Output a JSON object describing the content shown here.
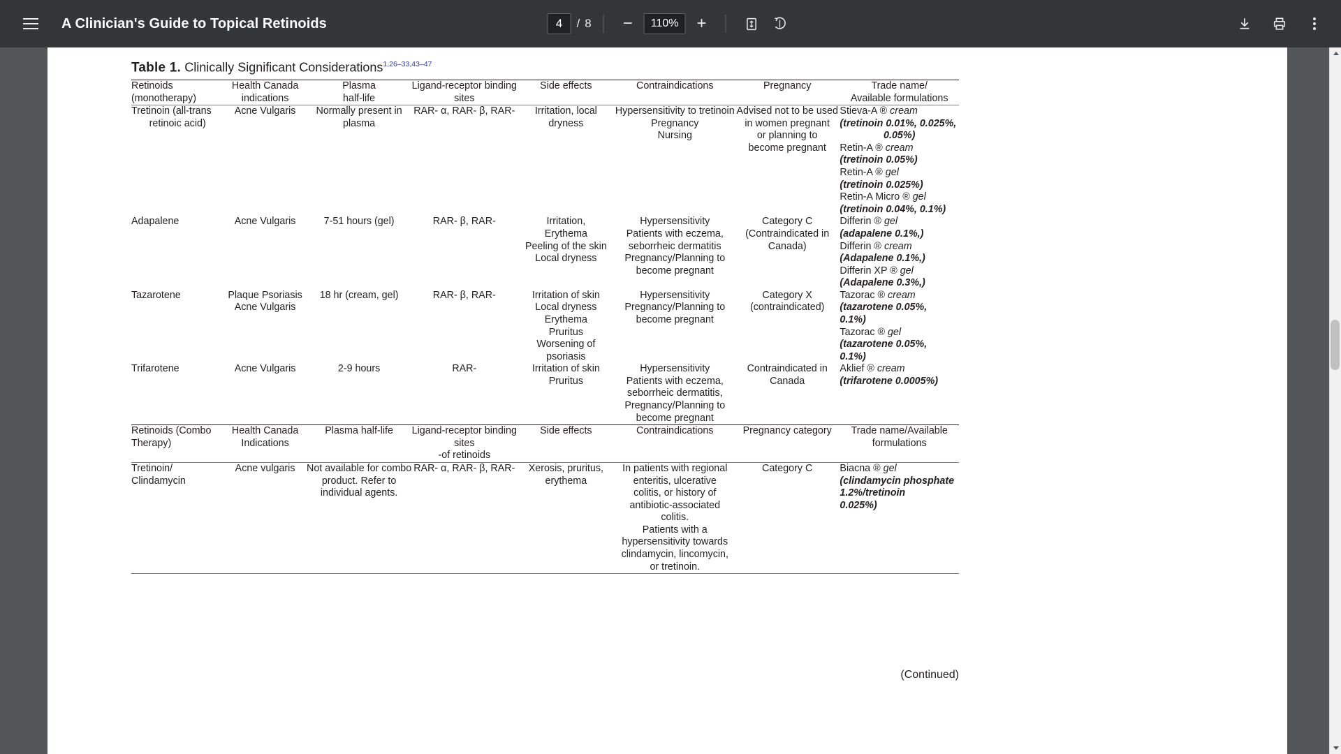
{
  "toolbar": {
    "menu_icon": "hamburger-menu-icon",
    "title": "A Clinician's Guide to Topical Retinoids",
    "page_current": "4",
    "page_separator": "/",
    "page_total": "8",
    "zoom_out_label": "−",
    "zoom_level": "110%",
    "zoom_in_label": "+",
    "fit_icon": "fit-to-page-icon",
    "rotate_icon": "rotate-icon",
    "download_icon": "download-icon",
    "print_icon": "print-icon",
    "more_icon": "more-options-icon"
  },
  "document": {
    "table_label": "Table 1.",
    "table_title": "Clinically Significant Considerations",
    "table_citation": "1,26–33,43–47",
    "continued": "(Continued)",
    "headers_mono": [
      "Retinoids (monotherapy)",
      "Health Canada indications",
      "Plasma half-life",
      "Ligand-receptor binding sites",
      "Side effects",
      "Contraindications",
      "Pregnancy",
      "Trade name/ Available formulations"
    ],
    "headers_mono_lines": {
      "name_l1": "Retinoids",
      "name_l2": "(monotherapy)",
      "ind_l1": "Health Canada",
      "ind_l2": "indications",
      "half_l1": "Plasma",
      "half_l2": "half-life",
      "lig_l1": "Ligand-receptor binding",
      "lig_l2": "sites",
      "side_l1": "Side effects",
      "contra_l1": "Contraindications",
      "preg_l1": "Pregnancy",
      "trade_l1": "Trade name/",
      "trade_l2": "Available formulations"
    },
    "headers_combo_lines": {
      "name_l1": "Retinoids (Combo",
      "name_l2": "Therapy)",
      "ind_l1": "Health Canada",
      "ind_l2": "Indications",
      "half_l1": "Plasma half-life",
      "lig_l1": "Ligand-receptor binding",
      "lig_l2": "sites",
      "lig_l3": "-of retinoids",
      "side_l1": "Side effects",
      "contra_l1": "Contraindications",
      "preg_l1": "Pregnancy category",
      "trade_l1": "Trade name/Available",
      "trade_l2": "formulations"
    },
    "rows_mono": [
      {
        "name_l1": "Tretinoin (all-trans",
        "name_l2": "retinoic acid)",
        "indications": "Acne Vulgaris",
        "half_l1": "Normally present in",
        "half_l2": "plasma",
        "ligand": "RAR- α, RAR- β, RAR-",
        "side_l1": "Irritation, local",
        "side_l2": "dryness",
        "contra_l1": "Hypersensitivity to tretinoin",
        "contra_l2": "Pregnancy",
        "contra_l3": "Nursing",
        "preg_l1": "Advised not to be used",
        "preg_l2": "in women pregnant",
        "preg_l3": "or planning to",
        "preg_l4": "become pregnant",
        "trade": [
          {
            "brand": "Stieva-A ® ",
            "type": "cream",
            "form_l1": "(tretinoin 0.01%, 0.025%,",
            "form_l2": "0.05%)"
          },
          {
            "brand": "Retin-A ® ",
            "type": "cream",
            "form_l1": "(tretinoin 0.05%)"
          },
          {
            "brand": "Retin-A ® ",
            "type": "gel",
            "form_l1": "(tretinoin 0.025%)"
          },
          {
            "brand": "Retin-A Micro ® ",
            "type": "gel",
            "form_l1": "(tretinoin 0.04%, 0.1%)"
          }
        ]
      },
      {
        "name_l1": "Adapalene",
        "indications": "Acne Vulgaris",
        "half_l1": "7-51 hours (gel)",
        "ligand": "RAR- β, RAR-",
        "side_l1": "Irritation,",
        "side_l2": "Erythema",
        "side_l3": "Peeling of the skin",
        "side_l4": "Local dryness",
        "contra_l1": "Hypersensitivity",
        "contra_l2": "Patients with eczema,",
        "contra_l3": "seborrheic dermatitis",
        "contra_l4": "Pregnancy/Planning to",
        "contra_l5": "become pregnant",
        "preg_l1": "Category C",
        "preg_l2": "(Contraindicated in",
        "preg_l3": "Canada)",
        "trade": [
          {
            "brand": "Differin ® ",
            "type": "gel",
            "form_l1": "(adapalene 0.1%,)"
          },
          {
            "brand": "Differin ® ",
            "type": "cream",
            "form_l1": "(Adapalene 0.1%,)"
          },
          {
            "brand": "Differin XP ® ",
            "type": "gel",
            "form_l1": "(Adapalene 0.3%,)"
          }
        ]
      },
      {
        "name_l1": "Tazarotene",
        "ind_l1": "Plaque Psoriasis",
        "ind_l2": "Acne Vulgaris",
        "half_l1": "18 hr (cream, gel)",
        "ligand": "RAR- β, RAR-",
        "side_l1": "Irritation of skin",
        "side_l2": "Local dryness",
        "side_l3": "Erythema",
        "side_l4": "Pruritus",
        "side_l5": "Worsening of",
        "side_l6": "psoriasis",
        "contra_l1": "Hypersensitivity",
        "contra_l2": "Pregnancy/Planning to",
        "contra_l3": "become pregnant",
        "preg_l1": "Category X",
        "preg_l2": "(contraindicated)",
        "trade": [
          {
            "brand": "Tazorac ® ",
            "type": "cream",
            "form_l1": "(tazarotene 0.05%,",
            "form_l2": "0.1%)"
          },
          {
            "brand": "Tazorac ® ",
            "type": "gel",
            "form_l1": "(tazarotene 0.05%,",
            "form_l2": "0.1%)"
          }
        ]
      },
      {
        "name_l1": "Trifarotene",
        "indications": "Acne Vulgaris",
        "half_l1": "2-9 hours",
        "ligand": "RAR-",
        "side_l1": "Irritation of skin",
        "side_l2": "Pruritus",
        "contra_l1": "Hypersensitivity",
        "contra_l2": "Patients with eczema,",
        "contra_l3": "seborrheic dermatitis,",
        "contra_l4": "Pregnancy/Planning to",
        "contra_l5": "become pregnant",
        "preg_l1": "Contraindicated in",
        "preg_l2": "Canada",
        "trade": [
          {
            "brand": "Aklief ® ",
            "type": "cream",
            "form_l1": "(trifarotene 0.0005%)"
          }
        ]
      }
    ],
    "rows_combo": [
      {
        "name_l1": "Tretinoin/",
        "name_l2": "Clindamycin",
        "indications": "Acne vulgaris",
        "half_l1": "Not available for combo",
        "half_l2": "product. Refer to",
        "half_l3": "individual agents.",
        "ligand": "RAR- α, RAR- β, RAR-",
        "side_l1": "Xerosis, pruritus,",
        "side_l2": "erythema",
        "contra_l1": "In patients with regional",
        "contra_l2": "enteritis, ulcerative",
        "contra_l3": "colitis, or history of",
        "contra_l4": "antibiotic-associated",
        "contra_l5": "colitis.",
        "contra_l6": "Patients with a",
        "contra_l7": "hypersensitivity towards",
        "contra_l8": "clindamycin, lincomycin,",
        "contra_l9": "or tretinoin.",
        "preg_l1": "Category C",
        "trade": [
          {
            "brand": "Biacna ® ",
            "type": "gel",
            "form_l1": "(clindamycin phosphate",
            "form_l2": "1.2%/tretinoin",
            "form_l3": "0.025%)"
          }
        ]
      }
    ]
  },
  "colors": {
    "toolbar_bg": "#323639",
    "citation_blue": "#2b36b8",
    "page_bg": "#ffffff",
    "viewer_bg": "#535659"
  }
}
